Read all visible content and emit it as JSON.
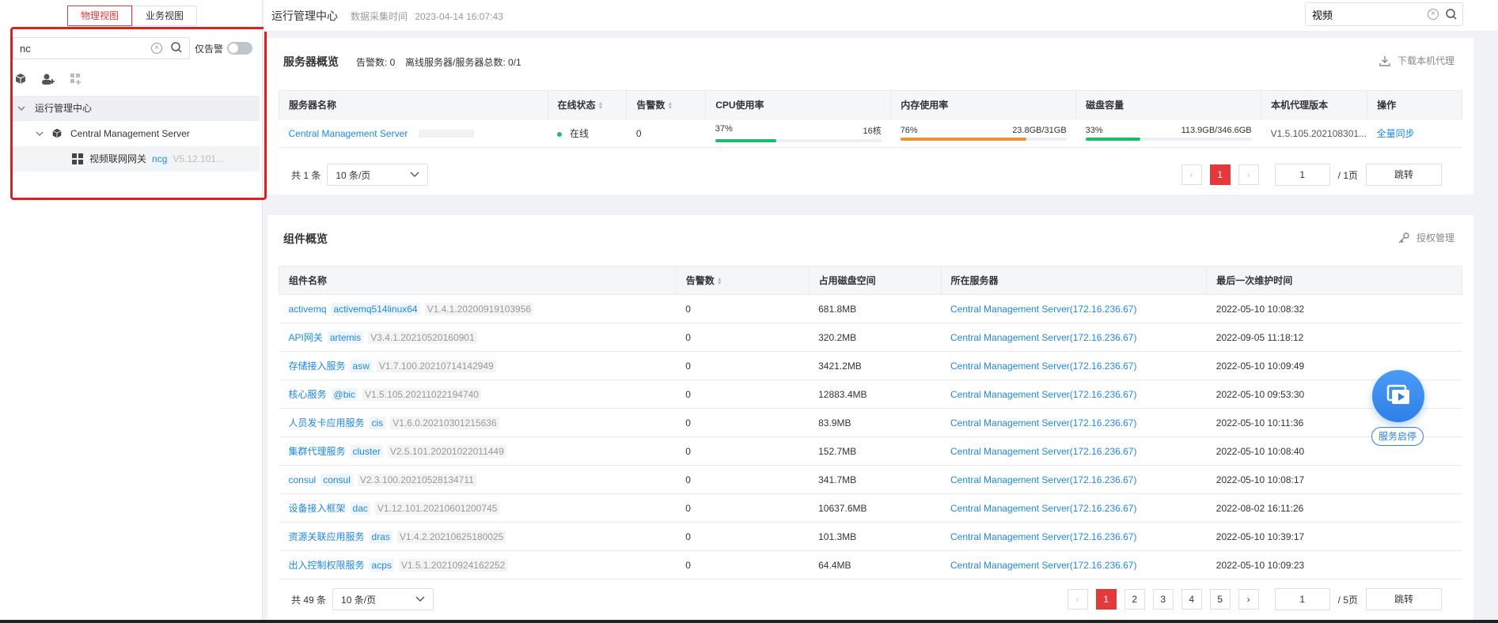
{
  "view_tabs": [
    "物理视图",
    "业务视图"
  ],
  "sidebar": {
    "search_value": "nc",
    "alarm_only_label": "仅告警",
    "tree": {
      "root": "运行管理中心",
      "server": "Central Management Server",
      "child": {
        "name": "视频联网网关",
        "tag": "ncg",
        "version": "V5.12.101..."
      }
    }
  },
  "header": {
    "title": "运行管理中心",
    "collect_label": "数据采集时间",
    "collect_time": "2023-04-14 16:07:43",
    "search_value": "视频"
  },
  "server_overview": {
    "title": "服务器概览",
    "alarm_count_label": "告警数: 0",
    "offline_label": "离线服务器/服务器总数: 0/1",
    "download_label": "下载本机代理",
    "columns": [
      "服务器名称",
      "在线状态",
      "告警数",
      "CPU使用率",
      "内存使用率",
      "磁盘容量",
      "本机代理版本",
      "操作"
    ],
    "rows": [
      {
        "name": "Central Management Server",
        "status": "在线",
        "alarms": "0",
        "cpu_pct": "37%",
        "cpu_detail": "16核",
        "cpu_fill": 37,
        "mem_pct": "76%",
        "mem_detail": "23.8GB/31GB",
        "mem_fill": 76,
        "disk_pct": "33%",
        "disk_detail": "113.9GB/346.6GB",
        "disk_fill": 33,
        "agent_version": "V1.5.105.202108301...",
        "action": "全量同步"
      }
    ],
    "total": "共 1 条",
    "page_size": "10 条/页",
    "pages": [
      "1"
    ],
    "current_page": "1",
    "page_total": "/ 1页",
    "jump_label": "跳转"
  },
  "component_overview": {
    "title": "组件概览",
    "license_label": "授权管理",
    "columns": [
      "组件名称",
      "告警数",
      "占用磁盘空间",
      "所在服务器",
      "最后一次维护时间"
    ],
    "rows": [
      {
        "name": "activemq",
        "tag": "activemq514linux64",
        "version": "V1.4.1.20200919103956",
        "alarms": "0",
        "disk": "681.8MB",
        "server": "Central Management Server(172.16.236.67)",
        "time": "2022-05-10 10:08:32"
      },
      {
        "name": "API网关",
        "tag": "artemis",
        "version": "V3.4.1.20210520160901",
        "alarms": "0",
        "disk": "320.2MB",
        "server": "Central Management Server(172.16.236.67)",
        "time": "2022-09-05 11:18:12"
      },
      {
        "name": "存储接入服务",
        "tag": "asw",
        "version": "V1.7.100.20210714142949",
        "alarms": "0",
        "disk": "3421.2MB",
        "server": "Central Management Server(172.16.236.67)",
        "time": "2022-05-10 10:09:49"
      },
      {
        "name": "核心服务",
        "tag": "@bic",
        "version": "V1.5.105.20211022194740",
        "alarms": "0",
        "disk": "12883.4MB",
        "server": "Central Management Server(172.16.236.67)",
        "time": "2022-05-10 09:53:30"
      },
      {
        "name": "人员发卡应用服务",
        "tag": "cis",
        "version": "V1.6.0.20210301215636",
        "alarms": "0",
        "disk": "83.9MB",
        "server": "Central Management Server(172.16.236.67)",
        "time": "2022-05-10 10:11:36"
      },
      {
        "name": "集群代理服务",
        "tag": "cluster",
        "version": "V2.5.101.20201022011449",
        "alarms": "0",
        "disk": "152.7MB",
        "server": "Central Management Server(172.16.236.67)",
        "time": "2022-05-10 10:08:40"
      },
      {
        "name": "consul",
        "tag": "consul",
        "version": "V2.3.100.20210528134711",
        "alarms": "0",
        "disk": "341.7MB",
        "server": "Central Management Server(172.16.236.67)",
        "time": "2022-05-10 10:08:17"
      },
      {
        "name": "设备接入框架",
        "tag": "dac",
        "version": "V1.12.101.20210601200745",
        "alarms": "0",
        "disk": "10637.6MB",
        "server": "Central Management Server(172.16.236.67)",
        "time": "2022-08-02 16:11:26"
      },
      {
        "name": "资源关联应用服务",
        "tag": "dras",
        "version": "V1.4.2.20210625180025",
        "alarms": "0",
        "disk": "101.3MB",
        "server": "Central Management Server(172.16.236.67)",
        "time": "2022-05-10 10:39:17"
      },
      {
        "name": "出入控制权限服务",
        "tag": "acps",
        "version": "V1.5.1.20210924162252",
        "alarms": "0",
        "disk": "64.4MB",
        "server": "Central Management Server(172.16.236.67)",
        "time": "2022-05-10 10:09:23"
      }
    ],
    "total": "共 49 条",
    "page_size": "10 条/页",
    "pages": [
      "1",
      "2",
      "3",
      "4",
      "5"
    ],
    "current_page": "1",
    "page_total": "/ 5页",
    "jump_label": "跳转"
  },
  "fab": {
    "label": "服务启停",
    "icon": "service-toggle-icon"
  },
  "colors": {
    "accent_red": "#e4393c",
    "link_blue": "#1e88e5",
    "cpu": "#19be6b",
    "mem": "#f0912f",
    "disk": "#19be6b"
  }
}
